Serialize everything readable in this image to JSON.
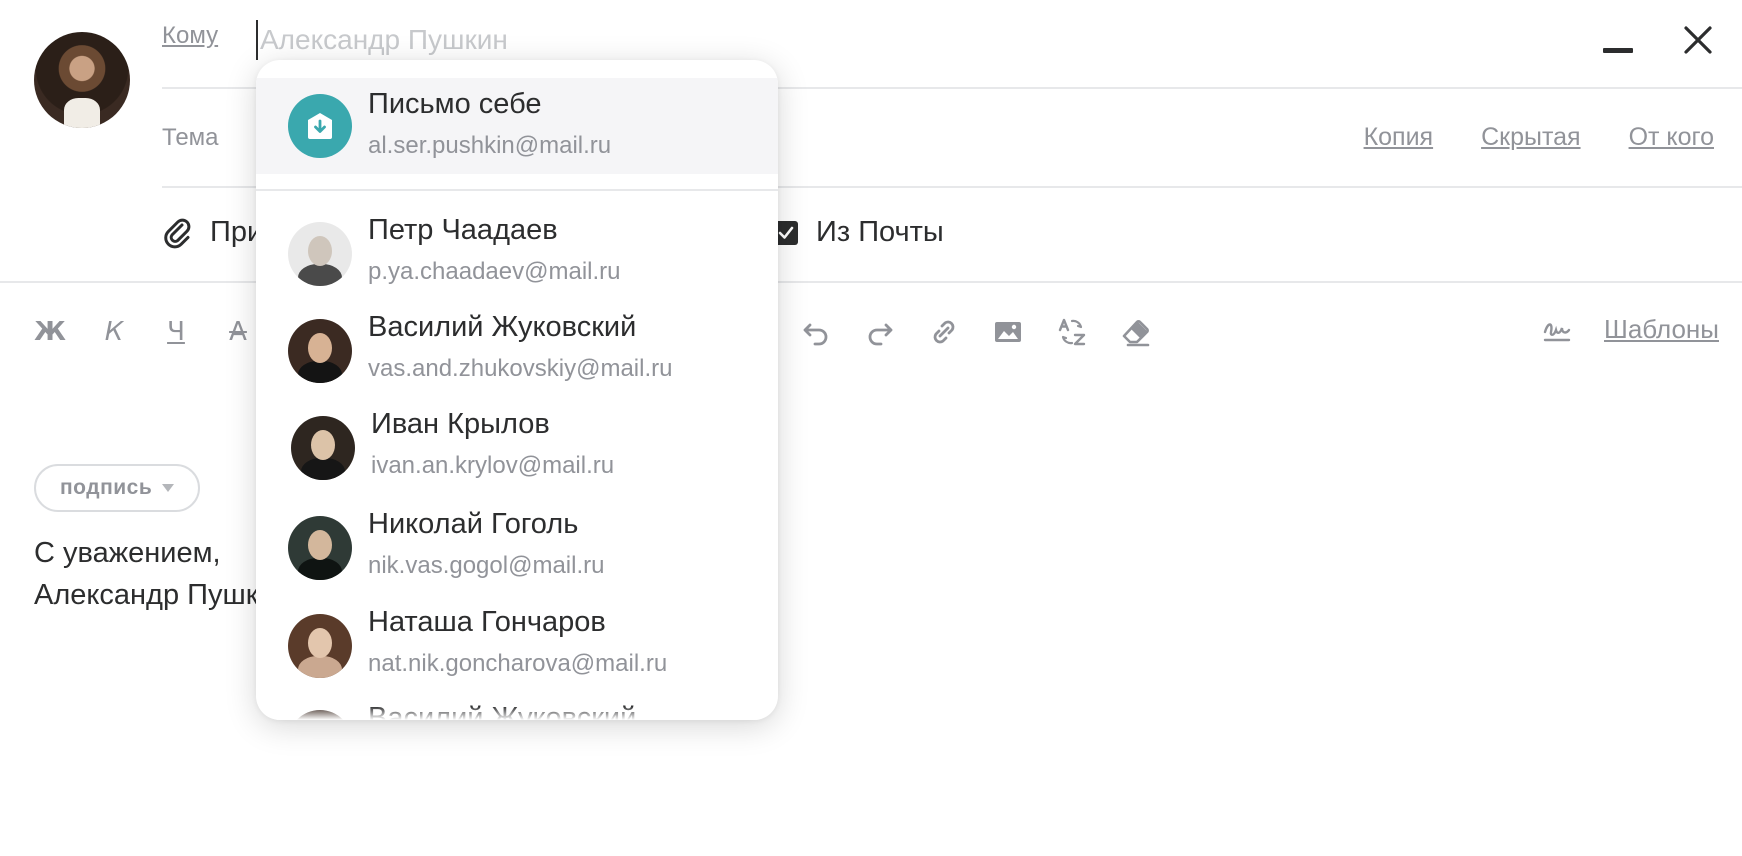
{
  "compose": {
    "to_label": "Кому",
    "to_placeholder": "Александр Пушкин",
    "subject_label": "Тема",
    "subject_links": {
      "copy": "Копия",
      "hidden": "Скрытая",
      "from": "От кого"
    },
    "attach_label": "Прикрепить файл",
    "from_mail_label": "Из Почты",
    "templates_label": "Шаблоны",
    "signature_button": "подпись",
    "body_lines": [
      "С уважением,",
      "Александр Пушкин"
    ]
  },
  "toolbar": {
    "bold": "Ж",
    "italic": "К",
    "underline": "Ч",
    "strike": "А"
  },
  "suggestions": {
    "self": {
      "name": "Письмо себе",
      "email": "al.ser.pushkin@mail.ru",
      "color": "#3aa8ae"
    },
    "contacts": [
      {
        "name": "Петр Чаадаев",
        "email": "p.ya.chaadaev@mail.ru"
      },
      {
        "name": "Василий Жуковский",
        "email": "vas.and.zhukovskiy@mail.ru"
      },
      {
        "name": "Иван Крылов",
        "email": "ivan.an.krylov@mail.ru"
      },
      {
        "name": "Николай Гоголь",
        "email": "nik.vas.gogol@mail.ru"
      },
      {
        "name": "Наташа Гончаров",
        "email": "nat.nik.goncharova@mail.ru"
      },
      {
        "name": "Василий Жуковский",
        "email": ""
      }
    ]
  }
}
